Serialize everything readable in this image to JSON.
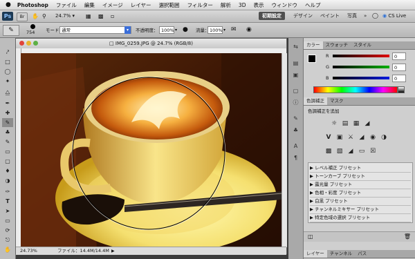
{
  "menubar": {
    "apple": "",
    "app_name": "Photoshop",
    "items": [
      "ファイル",
      "編集",
      "イメージ",
      "レイヤー",
      "選択範囲",
      "フィルター",
      "解析",
      "3D",
      "表示",
      "ウィンドウ",
      "ヘルプ"
    ]
  },
  "appbar": {
    "ps_logo": "Ps",
    "zoom": "24.7%",
    "workspaces": [
      "初期設定",
      "デザイン",
      "ペイント",
      "写真"
    ],
    "more": "»",
    "cs_live": "CS Live"
  },
  "options": {
    "brush_size": "754",
    "mode_label": "モード：",
    "mode_value": "通常",
    "opacity_label": "不透明度：",
    "opacity_value": "100%",
    "flow_label": "流量：",
    "flow_value": "100%"
  },
  "document": {
    "title": "IMG_0259.JPG @ 24.7% (RGB/8)",
    "zoom_status": "24.73%",
    "file_status": "ファイル：14.4M/14.4M"
  },
  "panels": {
    "color_tabs": [
      "カラー",
      "スウォッチ",
      "スタイル"
    ],
    "channels": [
      {
        "label": "R",
        "value": "0"
      },
      {
        "label": "G",
        "value": "0"
      },
      {
        "label": "B",
        "value": "0"
      }
    ],
    "adjust_tabs": [
      "色調補正",
      "マスク"
    ],
    "adjust_heading": "色調補正を追加",
    "presets": [
      "レベル補正 プリセット",
      "トーンカーブ プリセット",
      "露光量 プリセット",
      "色相・彩度 プリセット",
      "白黒 プリセット",
      "チャンネルミキサー プリセット",
      "特定色域の選択 プリセット"
    ],
    "layer_tabs": [
      "レイヤー",
      "チャンネル",
      "パス"
    ]
  },
  "colors": {
    "accent_red": "#e00000",
    "accent_green": "#00b000",
    "accent_blue": "#0018e0"
  }
}
